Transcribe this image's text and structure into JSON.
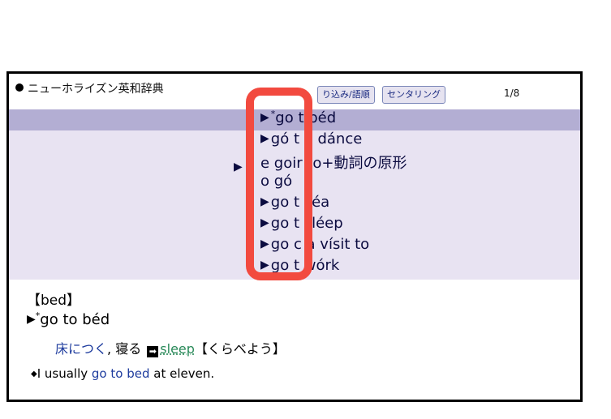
{
  "header": {
    "dictionary_title": "ニューホライズン英和辞典",
    "tab_sort": "り込み/語順",
    "tab_center_ring": "センタリング",
    "page_count": "1/8"
  },
  "list": {
    "items": [
      {
        "arrow": "▶",
        "sup": "*",
        "text": "go t  béd",
        "highlighted": true
      },
      {
        "arrow": "▶",
        "sup": "",
        "text": "gó t  a dánce"
      },
      {
        "arrow": "",
        "sup": "",
        "text": "e goir  to+動詞の原形"
      },
      {
        "arrow": "",
        "sup": "",
        "text": "o gó"
      },
      {
        "arrow": "▶",
        "sup": "",
        "text": "go t  séa"
      },
      {
        "arrow": "▶",
        "sup": "",
        "text": "go t  sléep"
      },
      {
        "arrow": "▶",
        "sup": "",
        "text": "go c  a vísit to"
      },
      {
        "arrow": "▶",
        "sup": "",
        "text": "go t  wórk"
      }
    ],
    "row3_left_arrow": "▶",
    "highlight_color": "#b3aed3",
    "background_color": "#e8e3f2"
  },
  "entry": {
    "headword": "【bed】",
    "phrase_arrow": "▶",
    "phrase_sup": "*",
    "phrase": "go to béd",
    "definition_blue": "床につく",
    "definition_black": ", 寝る",
    "arrow_icon": "➡",
    "link_word": "sleep",
    "compare_text": "【くらべよう】",
    "example_bullet": "◆",
    "example_pre": "I usually ",
    "example_highlight": "go to bed",
    "example_post": " at eleven."
  },
  "callout": {
    "color": "#f24a3f"
  }
}
